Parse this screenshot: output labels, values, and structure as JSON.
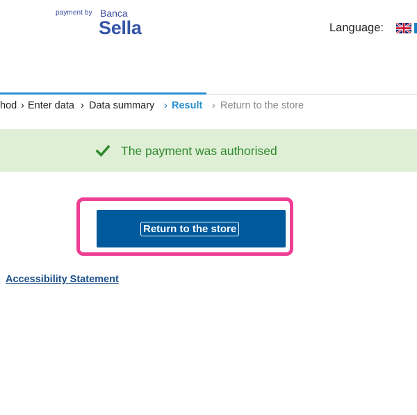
{
  "brand": {
    "prefix": "payment by",
    "bank": "Banca",
    "name": "Sella"
  },
  "language": {
    "label": "Language:",
    "current_flag": "uk-flag-icon"
  },
  "steps": [
    {
      "label": "hod",
      "state": "done"
    },
    {
      "label": "Enter data",
      "state": "done"
    },
    {
      "label": "Data summary",
      "state": "done"
    },
    {
      "label": "Result",
      "state": "active"
    },
    {
      "label": "Return to the store",
      "state": "pending"
    }
  ],
  "alert": {
    "icon": "checkmark-icon",
    "message": "The payment was authorised"
  },
  "actions": {
    "return_label": "Return to the store"
  },
  "footer": {
    "accessibility_label": "Accessibility Statement"
  },
  "colors": {
    "primary_button": "#005a9c",
    "active_step": "#2b8fd0",
    "success_bg": "#dfefd5",
    "success_text": "#2f8a2d",
    "highlight_frame": "#ef3f95"
  }
}
